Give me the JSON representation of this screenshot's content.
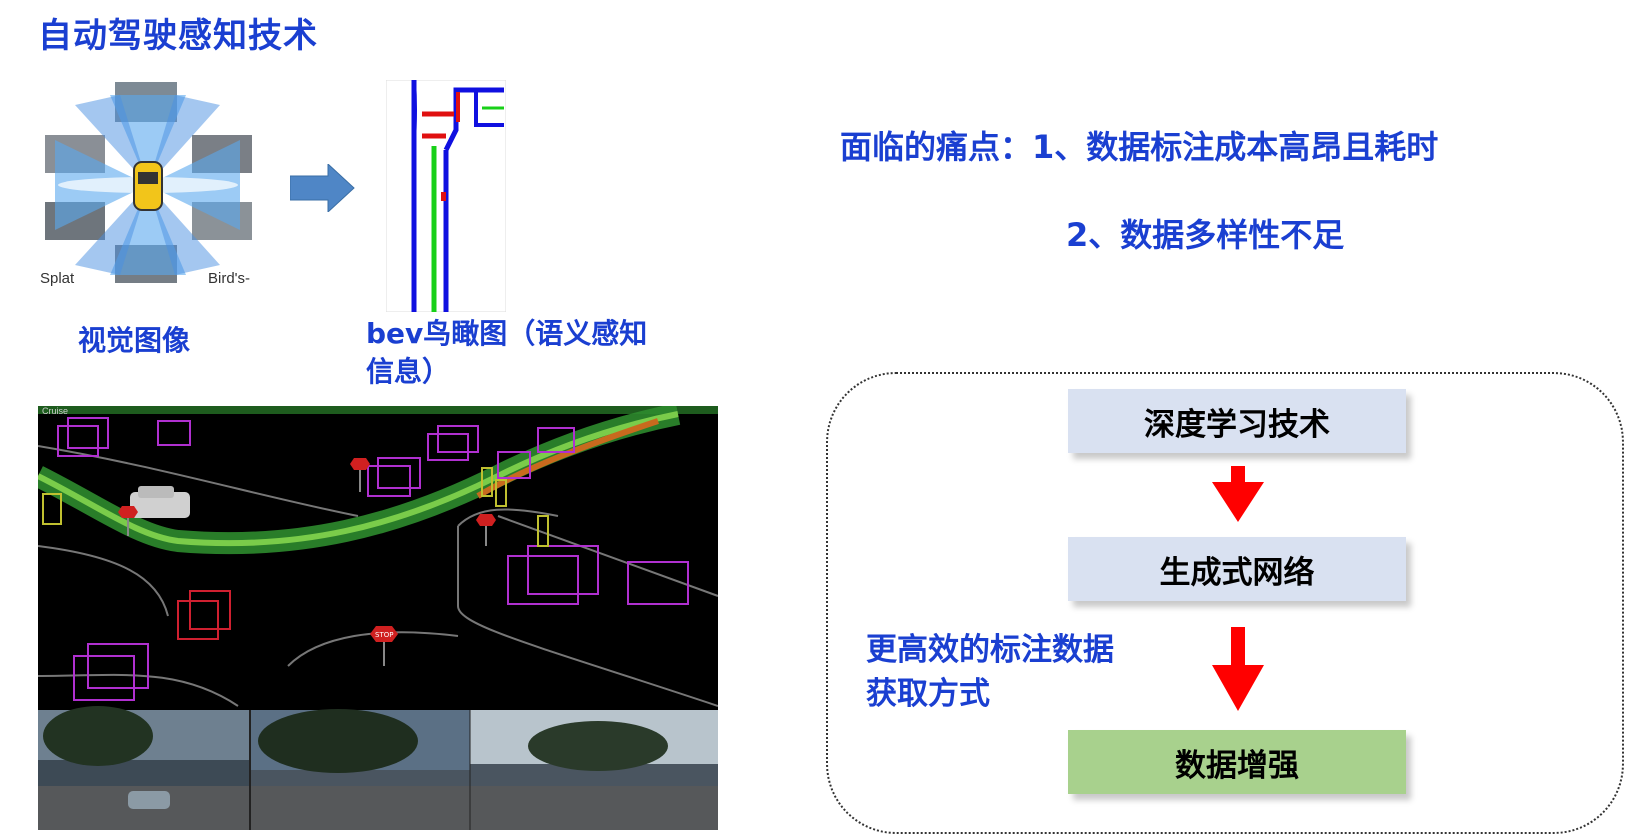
{
  "title": "自动驾驶感知技术",
  "captions": {
    "visual": "视觉图像",
    "bev": "bev鸟瞰图（语义感知信息）"
  },
  "figure_labels": {
    "splat": "Splat",
    "birds": "Bird's-",
    "cruise": "Cruise",
    "stop": "STOP"
  },
  "pain_points": {
    "line1": "面临的痛点：1、数据标注成本高昂且耗时",
    "line2": "2、数据多样性不足"
  },
  "flow": {
    "step1": "深度学习技术",
    "step2": "生成式网络",
    "step3": "数据增强",
    "side_note": "更高效的标注数据获取方式"
  },
  "colors": {
    "title": "#1a3fd1",
    "box_blue": "#d9e1f1",
    "box_green": "#a8d18d",
    "arrow_red": "#ff0000",
    "arrow_blue": "#4f86c6"
  }
}
